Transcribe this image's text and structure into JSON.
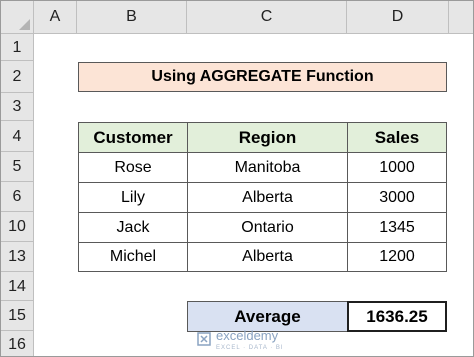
{
  "columns": [
    "A",
    "B",
    "C",
    "D"
  ],
  "rows": [
    "1",
    "2",
    "3",
    "4",
    "5",
    "6",
    "10",
    "13",
    "14",
    "15",
    "16"
  ],
  "title": "Using AGGREGATE Function",
  "table": {
    "headers": [
      "Customer",
      "Region",
      "Sales"
    ],
    "rows": [
      [
        "Rose",
        "Manitoba",
        "1000"
      ],
      [
        "Lily",
        "Alberta",
        "3000"
      ],
      [
        "Jack",
        "Ontario",
        "1345"
      ],
      [
        "Michel",
        "Alberta",
        "1200"
      ]
    ]
  },
  "average": {
    "label": "Average",
    "value": "1636.25"
  },
  "watermark": {
    "name": "exceldemy",
    "tagline": "EXCEL · DATA · BI"
  },
  "colors": {
    "title_fill": "#fce4d6",
    "header_fill": "#e2efda",
    "average_fill": "#d9e1f2",
    "watermark": "#8aa3c2"
  }
}
